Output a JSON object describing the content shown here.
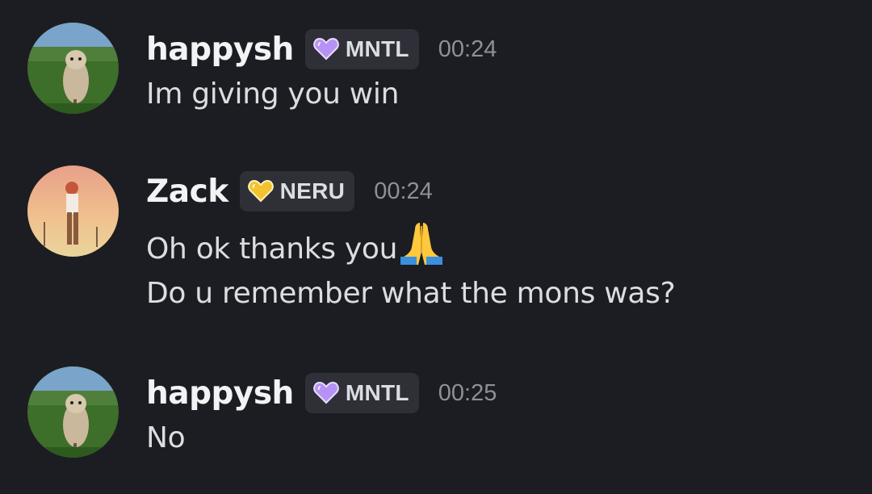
{
  "messages": [
    {
      "username": "happysh",
      "tag": "MNTL",
      "tag_color": "#b692f5",
      "timestamp": "00:24",
      "lines": [
        "Im giving you win"
      ]
    },
    {
      "username": "Zack",
      "tag": "NERU",
      "tag_color": "#f2c230",
      "timestamp": "00:24",
      "lines": [
        "Oh ok thanks you",
        "Do u remember what the mons was?"
      ],
      "emoji": "folded-hands"
    },
    {
      "username": "happysh",
      "tag": "MNTL",
      "tag_color": "#b692f5",
      "timestamp": "00:25",
      "lines": [
        "No"
      ]
    }
  ]
}
